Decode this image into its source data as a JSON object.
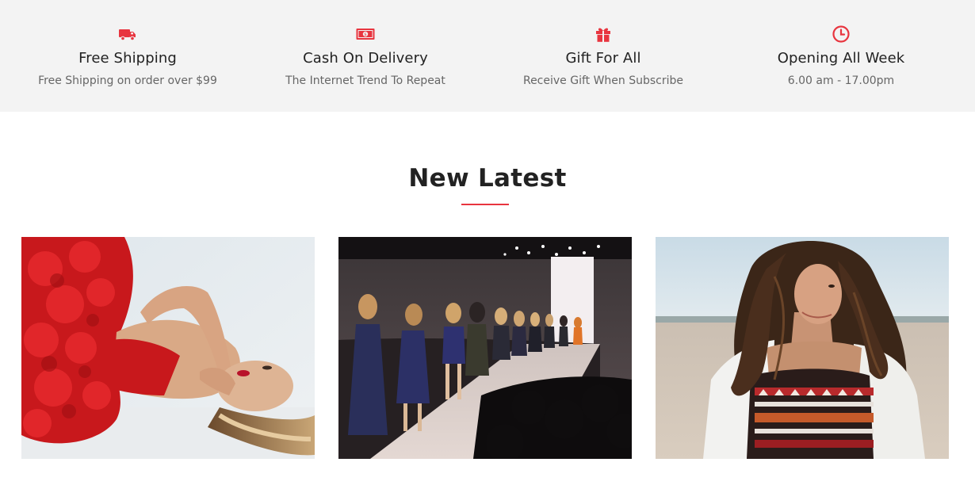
{
  "theme": {
    "accent": "#e8353f",
    "band_background": "#f3f3f3"
  },
  "features": [
    {
      "icon": "truck-icon",
      "title": "Free Shipping",
      "subtitle": "Free Shipping on order over $99"
    },
    {
      "icon": "money-icon",
      "title": "Cash On Delivery",
      "subtitle": "The Internet Trend To Repeat"
    },
    {
      "icon": "gift-icon",
      "title": "Gift For All",
      "subtitle": "Receive Gift When Subscribe"
    },
    {
      "icon": "clock-icon",
      "title": "Opening All Week",
      "subtitle": "6.00 am - 17.00pm"
    }
  ],
  "latest": {
    "heading": "New Latest",
    "cards": [
      {
        "image": "woman-red-dress-lying-photo"
      },
      {
        "image": "fashion-runway-models-photo"
      },
      {
        "image": "woman-curly-hair-beach-photo"
      }
    ]
  }
}
